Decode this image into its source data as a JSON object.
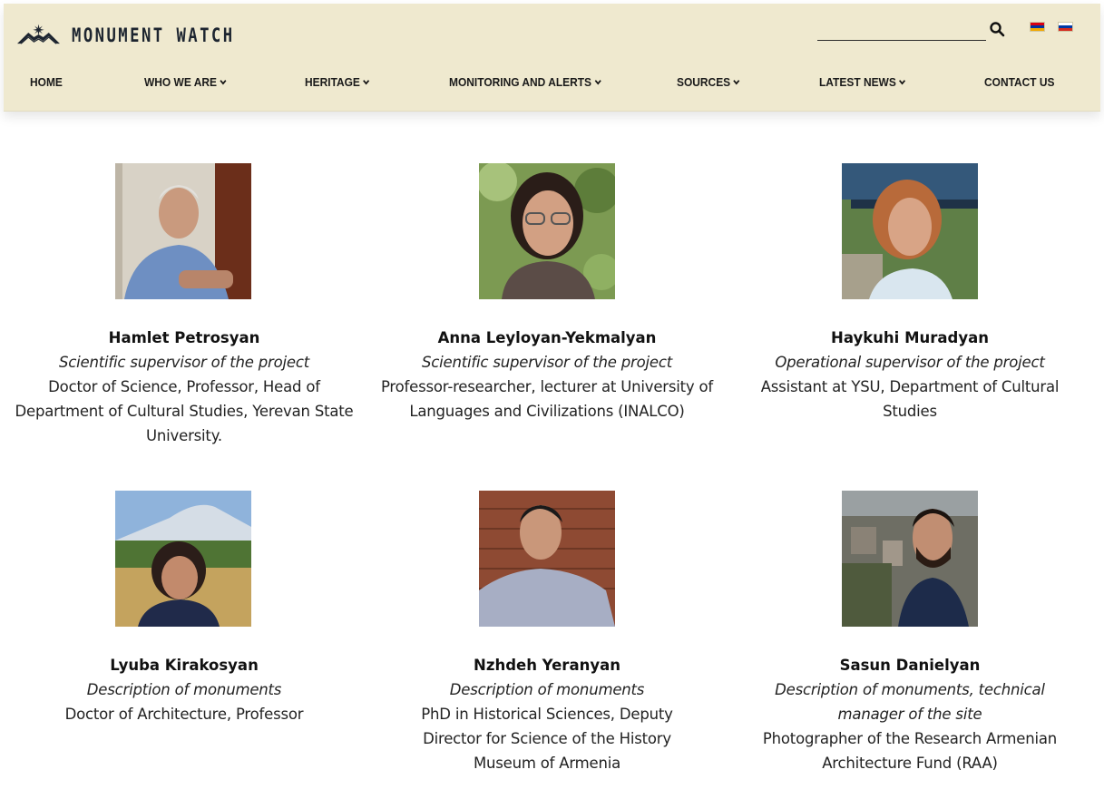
{
  "site": {
    "name": "MONUMENT WATCH"
  },
  "header": {
    "search": {
      "placeholder": ""
    },
    "languages": [
      "Armenian",
      "Russian"
    ],
    "colors": {
      "background": "#efe9cf",
      "text": "#1a1a1a"
    }
  },
  "nav": {
    "items": [
      {
        "label": "HOME",
        "dropdown": false
      },
      {
        "label": "WHO WE ARE",
        "dropdown": true
      },
      {
        "label": "HERITAGE",
        "dropdown": true
      },
      {
        "label": "MONITORING AND ALERTS",
        "dropdown": true
      },
      {
        "label": "SOURCES",
        "dropdown": true
      },
      {
        "label": "LATEST NEWS",
        "dropdown": true
      },
      {
        "label": "CONTACT US",
        "dropdown": false
      }
    ]
  },
  "team": [
    {
      "name": "Hamlet Petrosyan",
      "role": "Scientific supervisor of the project",
      "description": "Doctor of Science, Professor, Head of Department of Cultural Studies, Yerevan State University."
    },
    {
      "name": "Anna Leyloyan-Yekmalyan",
      "role": "Scientific supervisor of the project",
      "description": "Professor-researcher, lecturer at University of Languages and Civilizations (INALCO)"
    },
    {
      "name": "Haykuhi Muradyan",
      "role": "Operational supervisor of the project",
      "description": "Assistant at YSU, Department of Cultural Studies"
    },
    {
      "name": "Lyuba Kirakosyan",
      "role": "Description of monuments",
      "description": "Doctor of Architecture, Professor"
    },
    {
      "name": "Nzhdeh Yeranyan",
      "role": "Description of monuments",
      "description": "PhD in Historical Sciences, Deputy Director for Science of the History Museum of Armenia"
    },
    {
      "name": "Sasun Danielyan",
      "role": "Description of monuments, technical manager of the site",
      "description": "Photographer of the Research Armenian Architecture Fund (RAA)"
    }
  ]
}
